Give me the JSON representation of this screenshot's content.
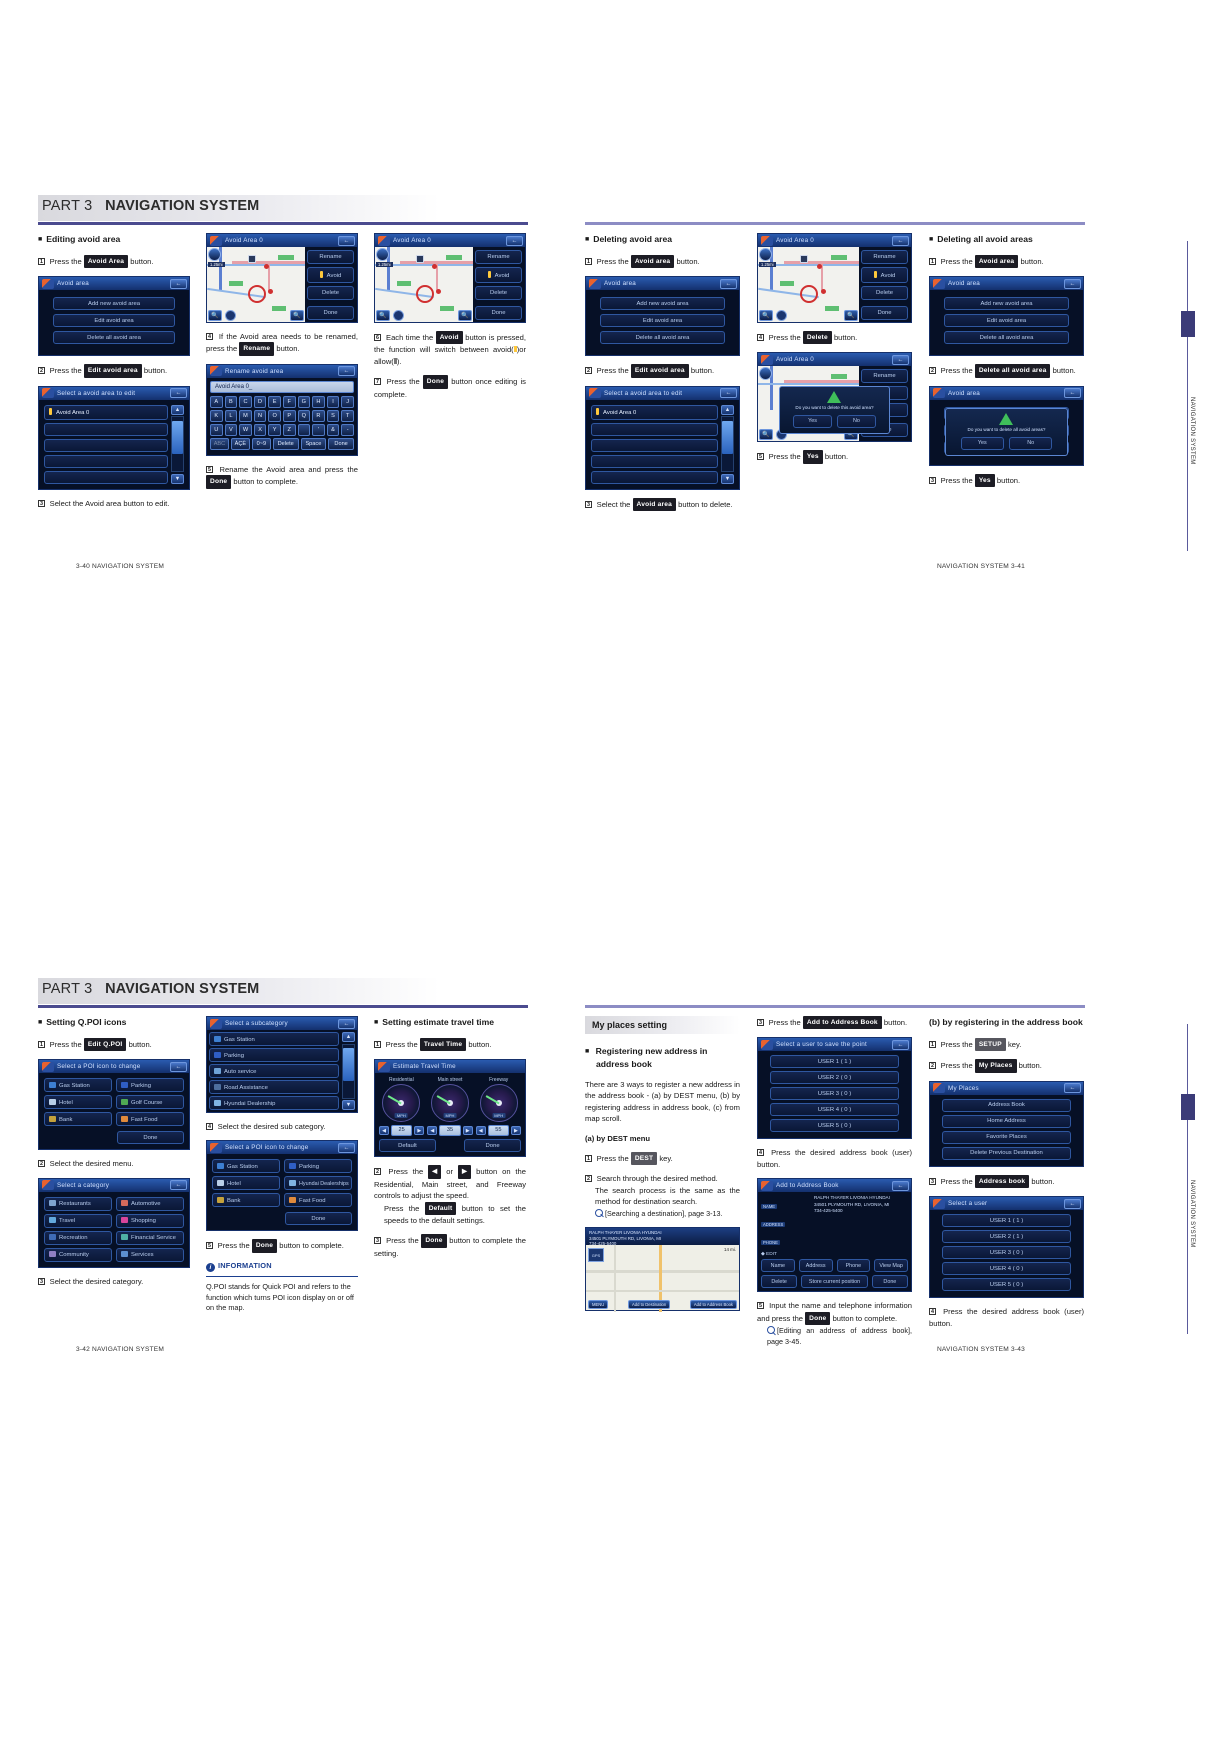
{
  "document": {
    "part_label": "PART 3",
    "part_title": "NAVIGATION SYSTEM",
    "side_tab_label": "NAVIGATION SYSTEM"
  },
  "spread_top": {
    "page_left": {
      "footer": "3-40   NAVIGATION SYSTEM",
      "col1": {
        "heading": "Editing avoid area",
        "step1_pre": "Press the",
        "step1_key": "Avoid Area",
        "step1_post": "button.",
        "screen1": {
          "title": "Avoid area",
          "buttons": [
            "Add new avoid area",
            "Edit avoid area",
            "Delete all avoid area"
          ]
        },
        "step2_pre": "Press the",
        "step2_key": "Edit avoid area",
        "step2_post": "button.",
        "screen2": {
          "title": "Select a avoid area to edit",
          "items": [
            "Avoid Area 0",
            "",
            "",
            "",
            ""
          ]
        },
        "step3": "Select the Avoid area button to edit."
      },
      "col2": {
        "screen1": {
          "title": "Avoid Area 0",
          "side_buttons": [
            "Rename",
            "Avoid",
            "Delete",
            "Done"
          ],
          "scale": "1.25mi"
        },
        "step4_pre": "If the Avoid area needs to be renamed, press the",
        "step4_key": "Rename",
        "step4_post": "button.",
        "screen2": {
          "title": "Rename avoid area",
          "input_value": "Avoid Area 0_",
          "rows": [
            [
              "A",
              "B",
              "C",
              "D",
              "E",
              "F",
              "G",
              "H",
              "I",
              "J"
            ],
            [
              "K",
              "L",
              "M",
              "N",
              "O",
              "P",
              "Q",
              "R",
              "S",
              "T"
            ],
            [
              "U",
              "V",
              "W",
              "X",
              "Y",
              "Z",
              "",
              "'",
              "&",
              "-"
            ],
            [
              "ABC",
              "ÀÇÈ",
              "0~9",
              "Delete",
              "Space",
              "Done"
            ]
          ]
        },
        "step5_pre": "Rename the Avoid area and press the",
        "step5_key": "Done",
        "step5_post": "button to complete."
      },
      "col3": {
        "screen1": {
          "title": "Avoid Area 0",
          "side_buttons": [
            "Rename",
            "Avoid",
            "Delete",
            "Done"
          ],
          "scale": "1.25mi"
        },
        "step6_pre": "Each time the",
        "step6_key": "Avoid",
        "step6_post": "button is pressed, the function will switch between avoid(",
        "step6_tail": ")or allow(",
        "step6_end": ").",
        "step7_pre": "Press the",
        "step7_key": "Done",
        "step7_post": "button once editing is complete."
      }
    },
    "page_right": {
      "footer": "NAVIGATION SYSTEM   3-41",
      "col1": {
        "heading": "Deleting avoid area",
        "step1_pre": "Press the",
        "step1_key": "Avoid area",
        "step1_post": "button.",
        "screen1": {
          "title": "Avoid area",
          "buttons": [
            "Add new avoid area",
            "Edit avoid area",
            "Delete all avoid area"
          ]
        },
        "step2_pre": "Press the",
        "step2_key": "Edit avoid area",
        "step2_post": "button.",
        "screen2": {
          "title": "Select a avoid area to edit",
          "items": [
            "Avoid Area 0",
            "",
            "",
            "",
            ""
          ]
        },
        "step3_pre": "Select the",
        "step3_key": "Avoid area",
        "step3_post": "button to delete."
      },
      "col2": {
        "screen1": {
          "title": "Avoid Area 0",
          "side_buttons": [
            "Rename",
            "Avoid",
            "Delete",
            "Done"
          ],
          "scale": "1.25mi"
        },
        "step4_pre": "Press the",
        "step4_key": "Delete",
        "step4_post": "button.",
        "screen2": {
          "title": "Avoid Area 0",
          "side_buttons": [
            "Rename",
            "Avoid",
            "Delete",
            "Done"
          ],
          "dialog_message": "Do you want to delete this avoid area?",
          "dialog_yes": "Yes",
          "dialog_no": "No"
        },
        "step5_pre": "Press the",
        "step5_key": "Yes",
        "step5_post": "button."
      },
      "col3": {
        "heading": "Deleting all avoid areas",
        "step1_pre": "Press the",
        "step1_key": "Avoid area",
        "step1_post": "button.",
        "screen1": {
          "title": "Avoid area",
          "buttons": [
            "Add new avoid area",
            "Edit avoid area",
            "Delete all avoid area"
          ]
        },
        "step2_pre": "Press the",
        "step2_key": "Delete all avoid area",
        "step2_post": "button.",
        "screen2": {
          "title": "Avoid area",
          "dialog_message": "Do you want to delete all avoid areas?",
          "dialog_yes": "Yes",
          "dialog_no": "No"
        },
        "step3_pre": "Press the",
        "step3_key": "Yes",
        "step3_post": "button."
      }
    }
  },
  "spread_bottom": {
    "page_left": {
      "footer": "3-42   NAVIGATION SYSTEM",
      "col1": {
        "heading": "Setting Q.POI icons",
        "step1_pre": "Press the",
        "step1_key": "Edit Q.POI",
        "step1_post": "button.",
        "screen1": {
          "title": "Select a POI icon to change",
          "items": [
            "Gas Station",
            "Parking",
            "Hotel",
            "Golf Course",
            "Bank",
            "Fast Food"
          ],
          "done": "Done"
        },
        "step2": "Select the desired menu.",
        "screen2": {
          "title": "Select a category",
          "items": [
            "Restaurants",
            "Automotive",
            "Travel",
            "Shopping",
            "Recreation",
            "Financial Service",
            "Community",
            "Services"
          ]
        },
        "step3": "Select the desired category."
      },
      "col2": {
        "screen1": {
          "title": "Select a subcategory",
          "items": [
            "Gas Station",
            "Parking",
            "Auto service",
            "Road Assistance",
            "Hyundai Dealership"
          ]
        },
        "step4": "Select the desired sub category.",
        "screen2": {
          "title": "Select a POI icon to change",
          "items": [
            "Gas Station",
            "Parking",
            "Hotel",
            "Hyundai Dealerships",
            "Bank",
            "Fast Food"
          ],
          "done": "Done"
        },
        "step5_pre": "Press the",
        "step5_key": "Done",
        "step5_post": "button to complete.",
        "info_title": "INFORMATION",
        "info_body": "Q.POI stands for Quick POI and refers to the function which turns POI icon display on or off on the map."
      },
      "col3": {
        "heading": "Setting estimate travel time",
        "step1_pre": "Press the",
        "step1_key": "Travel Time",
        "step1_post": "button.",
        "screen1": {
          "title": "Estimate Travel Time",
          "gauges": [
            {
              "label": "Residential",
              "value": "25",
              "unit": "MPH"
            },
            {
              "label": "Main street",
              "value": "35",
              "unit": "MPH"
            },
            {
              "label": "Freeway",
              "value": "55",
              "unit": "MPH"
            }
          ],
          "default": "Default",
          "done": "Done"
        },
        "step2_pre": "Press the",
        "step2_key_left": "◀",
        "step2_mid": "or",
        "step2_key_right": "▶",
        "step2_post": "button on the Residential, Main street, and Freeway controls to adjust the speed.",
        "step2b_pre": "Press the",
        "step2b_key": "Default",
        "step2b_post": "button to set the speeds to the default settings.",
        "step3_pre": "Press the",
        "step3_key": "Done",
        "step3_post": "button to complete the setting."
      }
    },
    "page_right": {
      "footer": "NAVIGATION SYSTEM   3-43",
      "col1": {
        "band": "My places setting",
        "heading_line1": "Registering new address in",
        "heading_line2": "address book",
        "intro": "There are 3 ways to register a new address in the address book - (a) by DEST menu, (b) by registering address in address book, (c) from map scroll.",
        "sub_a": "(a) by DEST menu",
        "step1_pre": "Press the",
        "step1_key": "DEST",
        "step1_post": "key.",
        "step2": "Search through the desired method.",
        "step2b": "The search process is the same as the method for destination search.",
        "step2_ref": "[Searching a destination], page 3-13.",
        "mapshot": {
          "line1": "RALPH THAYER LIVONIA HYUNDAI",
          "line2": "34501 PLYMOUTH RD, LIVONIA, MI",
          "line3": "734-425-5400",
          "dist": "14 mi.",
          "gps": "GPS",
          "btn_menu": "MENU",
          "btn_dest": "Add to Destination",
          "btn_addr": "Add to Address Book"
        }
      },
      "col2": {
        "step3_pre": "Press the",
        "step3_key": "Add to Address Book",
        "step3_post": "button.",
        "screen1": {
          "title": "Select a user to save the point",
          "items": [
            "USER 1 ( 1 )",
            "USER 2 ( 0 )",
            "USER 3 ( 0 )",
            "USER 4 ( 0 )",
            "USER 5 ( 0 )"
          ]
        },
        "step4": "Press the desired address book (user) button.",
        "screen2": {
          "title": "Add to Address Book",
          "fields": [
            {
              "tag": "NAME",
              "value": "RALPH THAYER LIVONIA HYUNDAI"
            },
            {
              "tag": "ADDRESS",
              "value": "34501 PLYMOUTH RD, LIVONIA, MI"
            },
            {
              "tag": "PHONE",
              "value": "734-425-5400"
            }
          ],
          "edit_label": "EDIT",
          "buttons_row1": [
            "Name",
            "Address",
            "Phone",
            "View Map"
          ],
          "buttons_row2": [
            "Delete",
            "Store current position",
            "Done"
          ]
        },
        "step5_pre": "Input the name and telephone information and press the",
        "step5_key": "Done",
        "step5_post": "button to complete.",
        "step5_ref": "[Editing an address of address book], page 3-45."
      },
      "col3": {
        "heading": "(b) by registering in the address book",
        "step1_pre": "Press the",
        "step1_key": "SETUP",
        "step1_post": "key.",
        "step2_pre": "Press the",
        "step2_key": "My Places",
        "step2_post": "button.",
        "screen1": {
          "title": "My Places",
          "buttons": [
            "Address Book",
            "Home Address",
            "Favorite Places",
            "Delete Previous Destination"
          ]
        },
        "step3_pre": "Press the",
        "step3_key": "Address book",
        "step3_post": "button.",
        "screen2": {
          "title": "Select a user",
          "items": [
            "USER 1 ( 1 )",
            "USER 2 ( 1 )",
            "USER 3 ( 0 )",
            "USER 4 ( 0 )",
            "USER 5 ( 0 )"
          ]
        },
        "step4": "Press the desired address book (user) button."
      }
    }
  },
  "colors": {
    "rule": "#4b4b8f",
    "screen_bg": "#061026",
    "screen_border": "#16306a",
    "key_bg": "#1c1c24",
    "accent_blue": "#1b3f8f"
  }
}
